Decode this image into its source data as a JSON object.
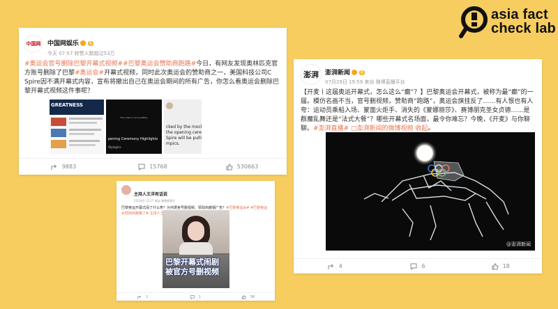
{
  "logo": {
    "line1": "asia fact",
    "line2": "check lab"
  },
  "post1": {
    "account_name": "中国网娱乐",
    "avatar_text": "中国网",
    "vip_badge": "8",
    "meta": "今天 07:57 转赞人数超过53万",
    "text_tags": "#奥运会官号删除巴黎开幕式视频##巴黎奥运会赞助商跑路#",
    "text_body": "今日，有网友发现奥林匹克官方账号删除了巴黎",
    "text_tag2": "#奥运会#",
    "text_body2": "开幕式视频，同时此次奥运会的赞助商之一，美国科技公司C Spire因不满开幕式内容，宣布将撤出自己在奥运会期间的所有广告，你怎么看奥运会删除巴黎开幕式视频这件事呢？",
    "thumb_greatness": "GREATNESS",
    "thumb_unavailable": "This video is not available.",
    "thumb_caption": "pening Ceremony Highlights",
    "thumb_olympics": "Olympics",
    "thumb_tweet": "cked by the mockery of t\nthe opening ceremonie\nSpire will be pulling our a\nmpics.",
    "share_count": "9883",
    "comment_count": "15768",
    "like_count": "530663"
  },
  "post2": {
    "account_name": "澎湃新闻",
    "avatar_text": "澎湃",
    "vip_badge": "8",
    "meta": "07月29日 19:59  来自 微博直播平台",
    "text_body": "【开麦丨这届奥运开幕式，怎么这么“癫”？】巴黎奥运会开幕式，被称为最“癫”的一届。模仿名画不当，官号删视频，赞助商“跑路”，奥运会旗挂反了……有人恨也有人夸：运动员乘船入场、蒙面火炬手、消失的《蒙娜丽莎》、赛博朋克圣女贞德……是群魔乱舞还是“法式大餐”？哪些开幕式名场面，最令你难忘？今晚，《开麦》与你聊聊。",
    "text_tag": "#澎湃直播#",
    "text_link": "澎湃新闻的微博视频",
    "text_more": "收起",
    "watermark": "@澎湃新闻",
    "share_count": "4",
    "comment_count": "6",
    "like_count": "18"
  },
  "post3": {
    "account_name": "主持人王洋有话说",
    "meta": "5月29日 15:17  来自 微博视频号",
    "text_body": "巴黎奥运开幕式闹了什么笑？为何遭官号删视频、赞助商撤钢广告？",
    "text_tags": "#巴黎奥运会# #巴黎奥运会赞助商跑路了#",
    "text_link": "主持人王洋有话说的微博视频",
    "caption_line1": "巴黎开幕式闹剧",
    "caption_line2": "被官方号删视频",
    "share_count": "1",
    "comment_count": "1",
    "like_count": "56"
  }
}
